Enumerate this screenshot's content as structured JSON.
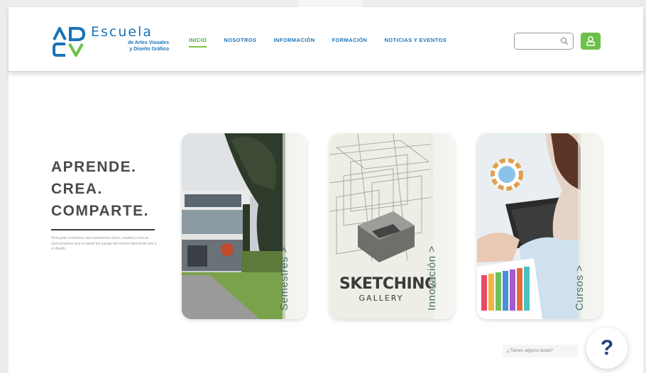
{
  "logo": {
    "title": "Escuela",
    "subtitle_line1": "de Artes Visuales",
    "subtitle_line2": "y Diseño Gráfico"
  },
  "nav": {
    "items": [
      {
        "label": "INICIO",
        "active": true
      },
      {
        "label": "NOSOTROS",
        "active": false
      },
      {
        "label": "INFORMACIÓN",
        "active": false
      },
      {
        "label": "FORMACIÓN",
        "active": false
      },
      {
        "label": "NOTICIAS Y EVENTOS",
        "active": false
      }
    ]
  },
  "search": {
    "placeholder": ""
  },
  "hero": {
    "line1": "APRENDE.",
    "line2": "CREA.",
    "line3": "COMPARTE.",
    "description": "Vive junto a nosotros una experiencia única, creativa y rica en conocimientos que te darán las pautas del mundo laboral del arte y el diseño."
  },
  "cards": [
    {
      "label": "Semestres >"
    },
    {
      "label": "Innovación >",
      "image_text_1": "SKETCHING",
      "image_text_2": "GALLERY"
    },
    {
      "label": "Cursos >"
    }
  ],
  "help": {
    "prompt": "¿Tienes alguna duda?",
    "button": "?"
  },
  "colors": {
    "brand_blue": "#1a73b8",
    "brand_green": "#6cc04a",
    "help_navy": "#1f3f7a"
  }
}
